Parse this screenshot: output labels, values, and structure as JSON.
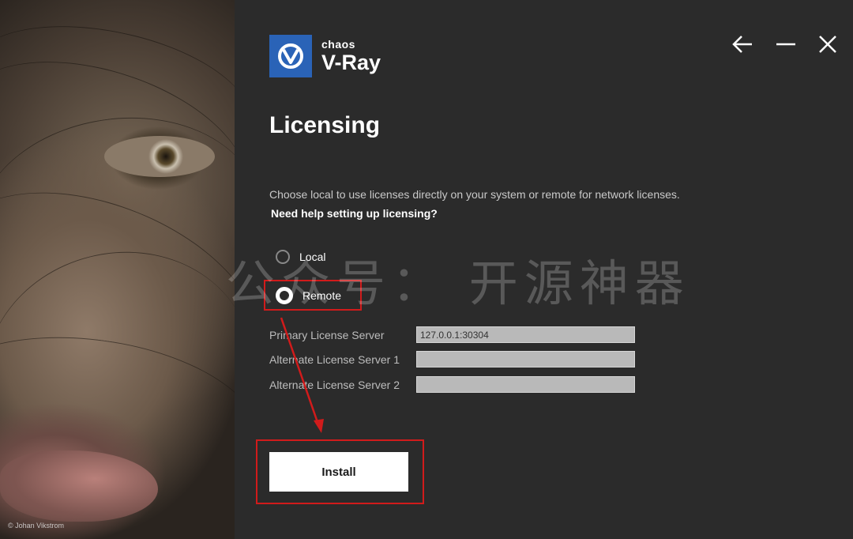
{
  "art": {
    "credit": "© Johan Vikstrom"
  },
  "brand": {
    "company": "chaos",
    "product": "V-Ray"
  },
  "window_controls": {
    "back_icon": "arrow-left-icon",
    "minimize_icon": "minimize-icon",
    "close_icon": "close-icon"
  },
  "page": {
    "title": "Licensing",
    "description": "Choose local to use licenses directly on your system or remote for network licenses.",
    "help_link": "Need help setting up licensing?"
  },
  "license_mode": {
    "options": [
      {
        "label": "Local",
        "selected": false
      },
      {
        "label": "Remote",
        "selected": true
      }
    ]
  },
  "servers": [
    {
      "label": "Primary License Server",
      "value": "127.0.0.1:30304"
    },
    {
      "label": "Alternate License Server 1",
      "value": ""
    },
    {
      "label": "Alternate License Server 2",
      "value": ""
    }
  ],
  "actions": {
    "install_label": "Install"
  },
  "overlay": {
    "watermark": "公众号： 开源神器"
  },
  "colors": {
    "accent": "#2a63b7",
    "annotation": "#d11b1b",
    "background": "#2b2b2b"
  }
}
